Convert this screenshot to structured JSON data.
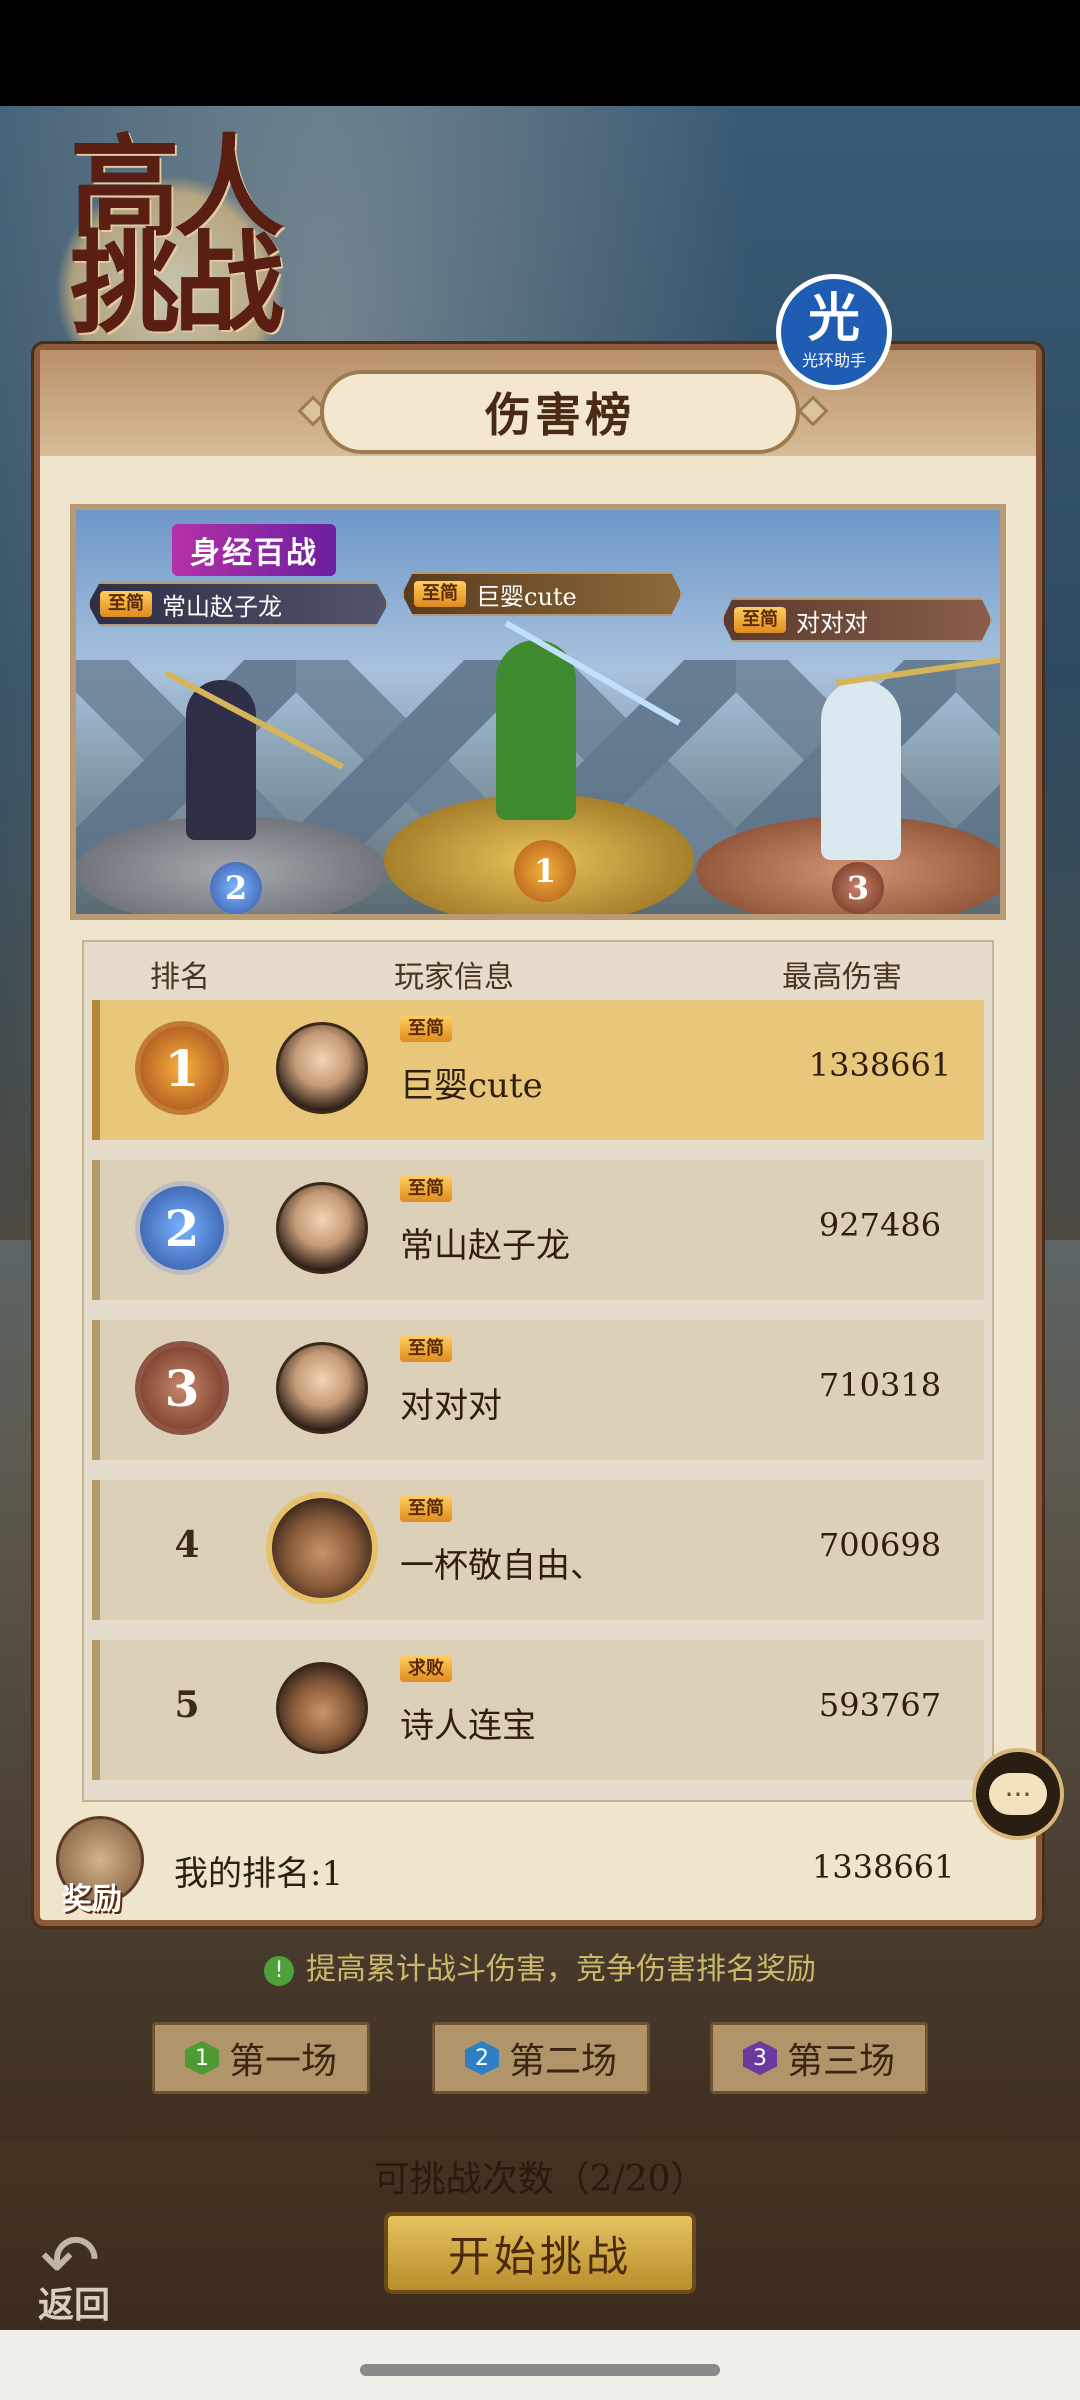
{
  "title_art": "高人\n挑战",
  "assistant": {
    "glyph": "光",
    "caption": "光环助手"
  },
  "panel_title": "伤害榜",
  "banner": {
    "event_label": "身经百战",
    "podium": [
      {
        "place": "2",
        "vip": "至简",
        "name": "常山赵子龙"
      },
      {
        "place": "1",
        "vip": "至简",
        "name": "巨婴cute"
      },
      {
        "place": "3",
        "vip": "至简",
        "name": "对对对"
      }
    ]
  },
  "table": {
    "headers": {
      "rank": "排名",
      "info": "玩家信息",
      "damage": "最高伤害"
    },
    "rows": [
      {
        "rank": "1",
        "vip": "至简",
        "name": "巨婴cute",
        "damage": "1338661"
      },
      {
        "rank": "2",
        "vip": "至简",
        "name": "常山赵子龙",
        "damage": "927486"
      },
      {
        "rank": "3",
        "vip": "至简",
        "name": "对对对",
        "damage": "710318"
      },
      {
        "rank": "4",
        "vip": "至简",
        "name": "一杯敬自由、",
        "damage": "700698"
      },
      {
        "rank": "5",
        "vip": "求败",
        "name": "诗人连宝",
        "damage": "593767"
      }
    ]
  },
  "my_rank": {
    "reward_label": "奖励",
    "label": "我的排名:1",
    "damage": "1338661"
  },
  "chat_icon": "···",
  "tip": {
    "icon": "!",
    "text": "提高累计战斗伤害，竞争伤害排名奖励"
  },
  "matches": [
    {
      "num": "1",
      "label": "第一场",
      "color": "#4e9a34"
    },
    {
      "num": "2",
      "label": "第二场",
      "color": "#2f7fc4"
    },
    {
      "num": "3",
      "label": "第三场",
      "color": "#6a3aa0"
    }
  ],
  "attempts": "可挑战次数（2/20）",
  "start_button": "开始挑战",
  "back": {
    "arrow": "↶",
    "label": "返回"
  }
}
